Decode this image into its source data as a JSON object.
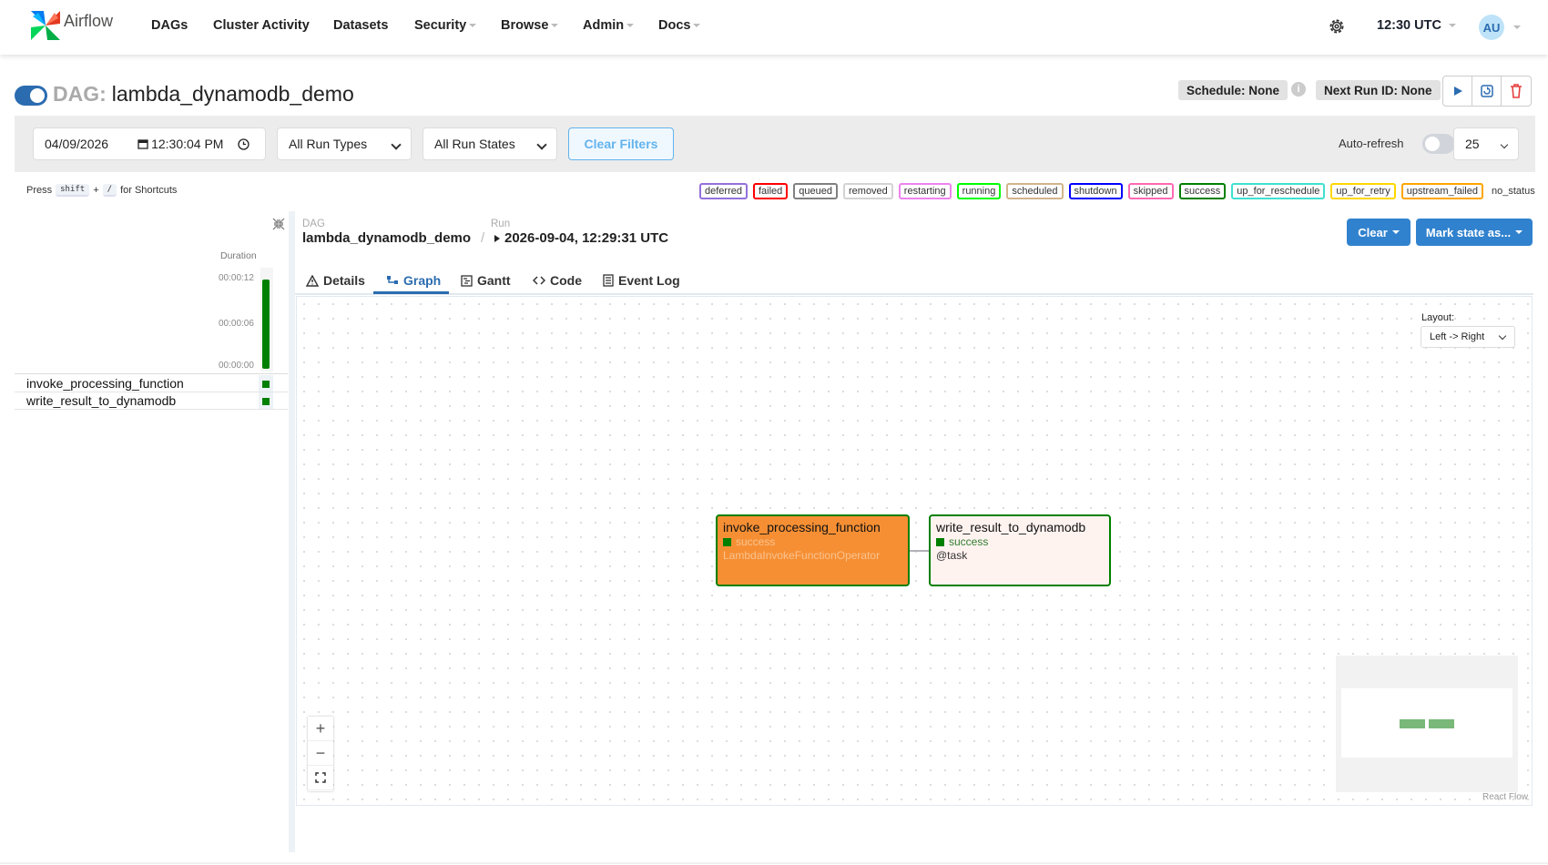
{
  "nav": {
    "brand": "Airflow",
    "items": [
      {
        "label": "DAGs",
        "dropdown": false
      },
      {
        "label": "Cluster Activity",
        "dropdown": false
      },
      {
        "label": "Datasets",
        "dropdown": false
      },
      {
        "label": "Security",
        "dropdown": true
      },
      {
        "label": "Browse",
        "dropdown": true
      },
      {
        "label": "Admin",
        "dropdown": true
      },
      {
        "label": "Docs",
        "dropdown": true
      }
    ],
    "time": "12:30 UTC",
    "avatar": "AU"
  },
  "dag": {
    "prefix": "DAG:",
    "name": "lambda_dynamodb_demo",
    "schedule": "Schedule: None",
    "next_run": "Next Run ID: None"
  },
  "filters": {
    "date": "04/09/2026",
    "time": "12:30:04 PM",
    "run_types": "All Run Types",
    "run_states": "All Run States",
    "clear_filters": "Clear Filters",
    "auto_refresh": "Auto-refresh",
    "page_size": "25"
  },
  "shortcut": {
    "press": "Press",
    "key1": "shift",
    "plus": "+",
    "key2": "/",
    "suffix": "for Shortcuts"
  },
  "legend": [
    {
      "label": "deferred",
      "color": "#9370db"
    },
    {
      "label": "failed",
      "color": "#ff0000"
    },
    {
      "label": "queued",
      "color": "#808080"
    },
    {
      "label": "removed",
      "color": "#d3d3d3"
    },
    {
      "label": "restarting",
      "color": "#ee82ee"
    },
    {
      "label": "running",
      "color": "#00ff00"
    },
    {
      "label": "scheduled",
      "color": "#d2b48c"
    },
    {
      "label": "shutdown",
      "color": "#0000ff"
    },
    {
      "label": "skipped",
      "color": "#ff69b4"
    },
    {
      "label": "success",
      "color": "#008000"
    },
    {
      "label": "up_for_reschedule",
      "color": "#40e0d0"
    },
    {
      "label": "up_for_retry",
      "color": "#ffd700"
    },
    {
      "label": "upstream_failed",
      "color": "#ffa500"
    }
  ],
  "legend_none": "no_status",
  "grid": {
    "duration_label": "Duration",
    "ticks": [
      "00:00:12",
      "00:00:06",
      "00:00:00"
    ],
    "tasks": [
      "invoke_processing_function",
      "write_result_to_dynamodb"
    ]
  },
  "run_header": {
    "dag_label": "DAG",
    "dag_value": "lambda_dynamodb_demo",
    "run_label": "Run",
    "run_value": "2026-09-04, 12:29:31 UTC",
    "clear_btn": "Clear",
    "mark_btn": "Mark state as..."
  },
  "tabs": [
    "Details",
    "Graph",
    "Gantt",
    "Code",
    "Event Log"
  ],
  "graph": {
    "layout_label": "Layout:",
    "layout_value": "Left -> Right",
    "nodes": [
      {
        "title": "invoke_processing_function",
        "status": "success",
        "operator": "LambdaInvokeFunctionOperator",
        "bg": "#f68f34",
        "op_color": "#f9c38e"
      },
      {
        "title": "write_result_to_dynamodb",
        "status": "success",
        "operator": "@task",
        "bg": "#fff3f0",
        "op_color": "#333"
      }
    ],
    "attribution": "React Flow"
  },
  "colors": {
    "accent": "#3182ce",
    "success": "#008000"
  }
}
